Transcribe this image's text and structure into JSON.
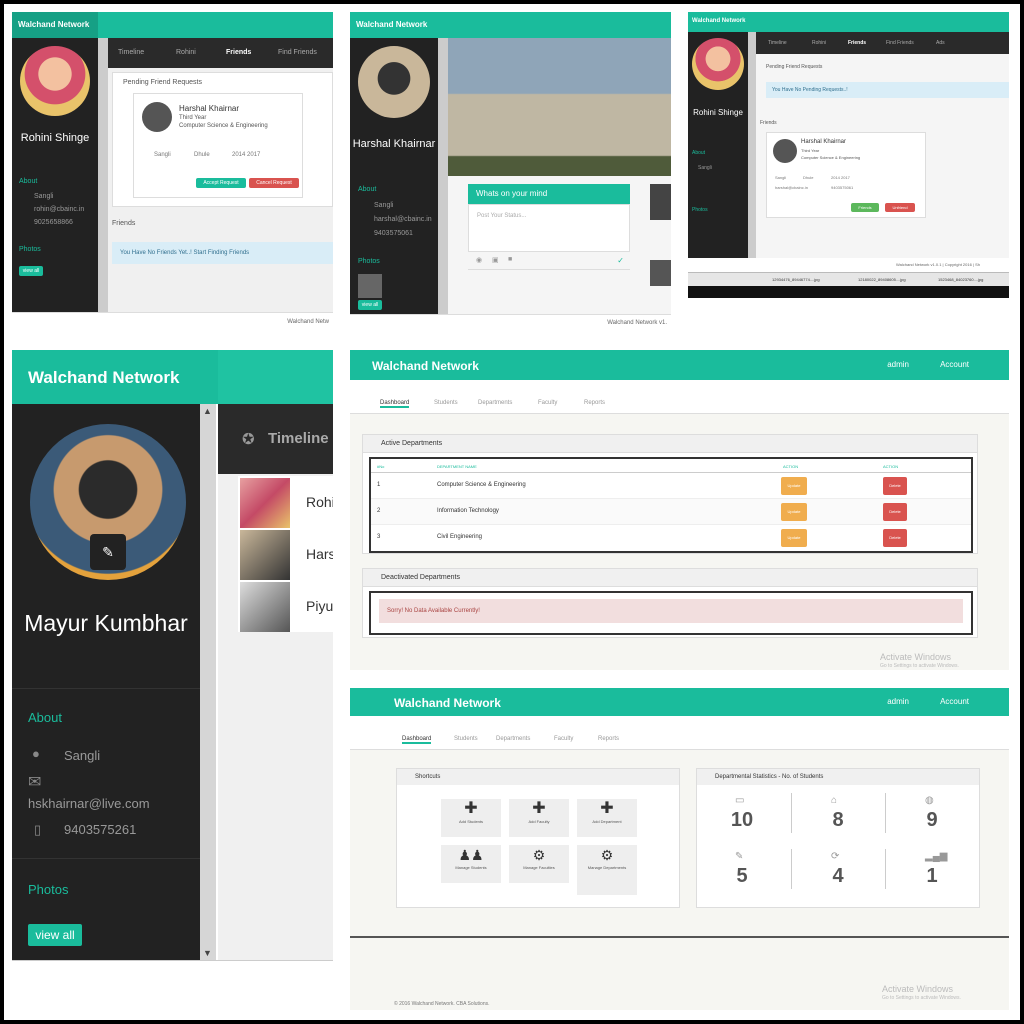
{
  "brand": "Walchand Network",
  "colors": {
    "accent": "#1abc9c",
    "sidebar": "#222222",
    "danger": "#d9534f",
    "warning": "#f0ad4e",
    "success": "#5cb85c"
  },
  "p1": {
    "user": "Rohini Shinge",
    "tabs": [
      "Timeline",
      "Rohini",
      "Friends",
      "Find Friends"
    ],
    "pending_title": "Pending Friend Requests",
    "req_name": "Harshal Khairnar",
    "req_year": "Third Year",
    "req_dept": "Computer Science & Engineering",
    "req_city": "Sangli",
    "req_city2": "Dhule",
    "req_years": "2014 2017",
    "accept": "Accept Request",
    "cancel": "Cancel Request",
    "about": "About",
    "city": "Sangli",
    "email": "rohin@cbainc.in",
    "phone": "9025658866",
    "photos": "Photos",
    "view_all": "view all",
    "friends": "Friends",
    "no_friends": "You Have No Friends Yet..! Start Finding Friends",
    "footer": "Walchand Netw"
  },
  "p2": {
    "user": "Harshal Khairnar",
    "about": "About",
    "city": "Sangli",
    "email": "harshal@cbainc.in",
    "phone": "9403575061",
    "photos": "Photos",
    "view_all": "view all",
    "whats": "Whats on your mind",
    "placeholder": "Post Your Status...",
    "footer": "Walchand Network v1."
  },
  "p3": {
    "user": "Rohini Shinge",
    "tabs": [
      "Timeline",
      "Rohini",
      "Friends",
      "Find Friends",
      "Ads"
    ],
    "pending": "Pending Friend Requests",
    "no_pending": "You Have No Pending Requests..!",
    "friends": "Friends",
    "name": "Harshal Khairnar",
    "year": "Third Year",
    "dept": "Computer Science & Engineering",
    "city": "Sangli",
    "city2": "Dhule",
    "years": "2014 2017",
    "email": "harshal@cbainc.in",
    "phone": "9403575061",
    "friends_btn": "Friends",
    "unfriend": "Unfriend",
    "about": "About",
    "photos": "Photos",
    "footer": "Walchand Network v1.0.1 | Copyright 2016 | Sh",
    "task_files": [
      "12934476_89446774....jpg",
      "12180022_89408605....jpg",
      "1523468_84023760....jpg"
    ]
  },
  "p4": {
    "user": "Mayur Kumbhar",
    "timeline": "Timeline",
    "friends": [
      "Rohi",
      "Hars",
      "Piyu"
    ],
    "about": "About",
    "city": "Sangli",
    "email": "hskhairnar@live.com",
    "phone": "9403575261",
    "photos": "Photos",
    "view_all": "view all"
  },
  "p5": {
    "admin": "admin",
    "account": "Account",
    "nav": [
      "Dashboard",
      "Students",
      "Departments",
      "Faculty",
      "Reports"
    ],
    "active_title": "Active Departments",
    "cols": [
      "#No",
      "DEPARTMENT NAME",
      "ACTION",
      "ACTION"
    ],
    "rows": [
      {
        "no": "1",
        "name": "Computer Science & Engineering"
      },
      {
        "no": "2",
        "name": "Information Technology"
      },
      {
        "no": "3",
        "name": "Civil Engineering"
      }
    ],
    "edit": "Update",
    "delete": "Delete",
    "deact_title": "Deactivated Departments",
    "no_data": "Sorry! No Data Available Currently!",
    "activate": "Activate Windows",
    "activate_sub": "Go to Settings to activate Windows."
  },
  "p6": {
    "admin": "admin",
    "account": "Account",
    "nav": [
      "Dashboard",
      "Students",
      "Departments",
      "Faculty",
      "Reports"
    ],
    "shortcuts": "Shortcuts",
    "sc": [
      "Add Students",
      "Add Faculty",
      "Add Department",
      "Manage Students",
      "Manage Faculties",
      "Manage Departments"
    ],
    "stats_title": "Departmental Statistics - No. of Students",
    "stats": [
      "10",
      "8",
      "9",
      "5",
      "4",
      "1"
    ],
    "activate": "Activate Windows",
    "activate_sub": "Go to Settings to activate Windows.",
    "footer": "© 2016 Walchand Network. CBA Solutions."
  }
}
